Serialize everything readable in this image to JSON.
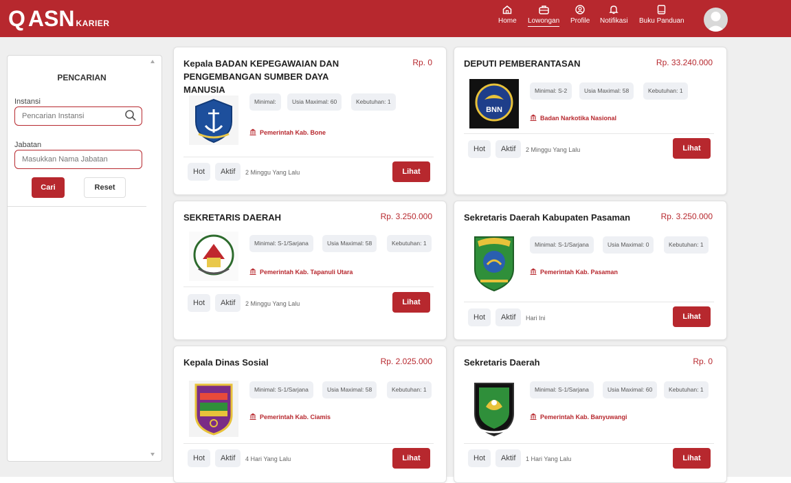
{
  "brand": {
    "q": "Q",
    "asn": "ASN",
    "karier": "KARIER"
  },
  "colors": {
    "primary": "#b7282e",
    "chip_bg": "#eef0f4",
    "page_bg": "#efefef"
  },
  "nav": [
    {
      "label": "Home",
      "icon": "home-icon"
    },
    {
      "label": "Lowongan",
      "icon": "briefcase-icon",
      "active": true
    },
    {
      "label": "Profile",
      "icon": "profile-icon"
    },
    {
      "label": "Notifikasi",
      "icon": "bell-icon"
    },
    {
      "label": "Buku Panduan",
      "icon": "book-icon"
    }
  ],
  "sidebar": {
    "title": "PENCARIAN",
    "instansi_label": "Instansi",
    "instansi_placeholder": "Pencarian Instansi",
    "jabatan_label": "Jabatan",
    "jabatan_placeholder": "Masukkan Nama Jabatan",
    "cari": "Cari",
    "reset": "Reset"
  },
  "jobs": [
    {
      "title": "Kepala BADAN KEPEGAWAIAN DAN PENGEMBANGAN SUMBER DAYA MANUSIA",
      "salary": "Rp. 0",
      "minimal": "Minimal:",
      "usia": "Usia Maximal: 60",
      "kebutuhan": "Kebutuhan: 1",
      "instansi": "Pemerintah Kab. Bone",
      "hot": "Hot",
      "aktif": "Aktif",
      "time": "2 Minggu Yang Lalu",
      "lihat": "Lihat"
    },
    {
      "title": "DEPUTI PEMBERANTASAN",
      "salary": "Rp. 33.240.000",
      "minimal": "Minimal: S-2",
      "usia": "Usia Maximal: 58",
      "kebutuhan": "Kebutuhan: 1",
      "instansi": "Badan Narkotika Nasional",
      "logo_text": "BNN",
      "hot": "Hot",
      "aktif": "Aktif",
      "time": "2 Minggu Yang Lalu",
      "lihat": "Lihat"
    },
    {
      "title": "SEKRETARIS DAERAH",
      "salary": "Rp. 3.250.000",
      "minimal": "Minimal: S-1/Sarjana",
      "usia": "Usia Maximal: 58",
      "kebutuhan": "Kebutuhan: 1",
      "instansi": "Pemerintah Kab. Tapanuli Utara",
      "hot": "Hot",
      "aktif": "Aktif",
      "time": "2 Minggu Yang Lalu",
      "lihat": "Lihat"
    },
    {
      "title": "Sekretaris Daerah Kabupaten Pasaman",
      "salary": "Rp. 3.250.000",
      "minimal": "Minimal: S-1/Sarjana",
      "usia": "Usia Maximal: 0",
      "kebutuhan": "Kebutuhan: 1",
      "instansi": "Pemerintah Kab. Pasaman",
      "hot": "Hot",
      "aktif": "Aktif",
      "time": "Hari Ini",
      "lihat": "Lihat"
    },
    {
      "title": "Kepala Dinas Sosial",
      "salary": "Rp. 2.025.000",
      "minimal": "Minimal: S-1/Sarjana",
      "usia": "Usia Maximal: 58",
      "kebutuhan": "Kebutuhan: 1",
      "instansi": "Pemerintah Kab. Ciamis",
      "hot": "Hot",
      "aktif": "Aktif",
      "time": "4 Hari Yang Lalu",
      "lihat": "Lihat"
    },
    {
      "title": "Sekretaris Daerah",
      "salary": "Rp. 0",
      "minimal": "Minimal: S-1/Sarjana",
      "usia": "Usia Maximal: 60",
      "kebutuhan": "Kebutuhan: 1",
      "instansi": "Pemerintah Kab. Banyuwangi",
      "hot": "Hot",
      "aktif": "Aktif",
      "time": "1 Hari Yang Lalu",
      "lihat": "Lihat"
    }
  ]
}
